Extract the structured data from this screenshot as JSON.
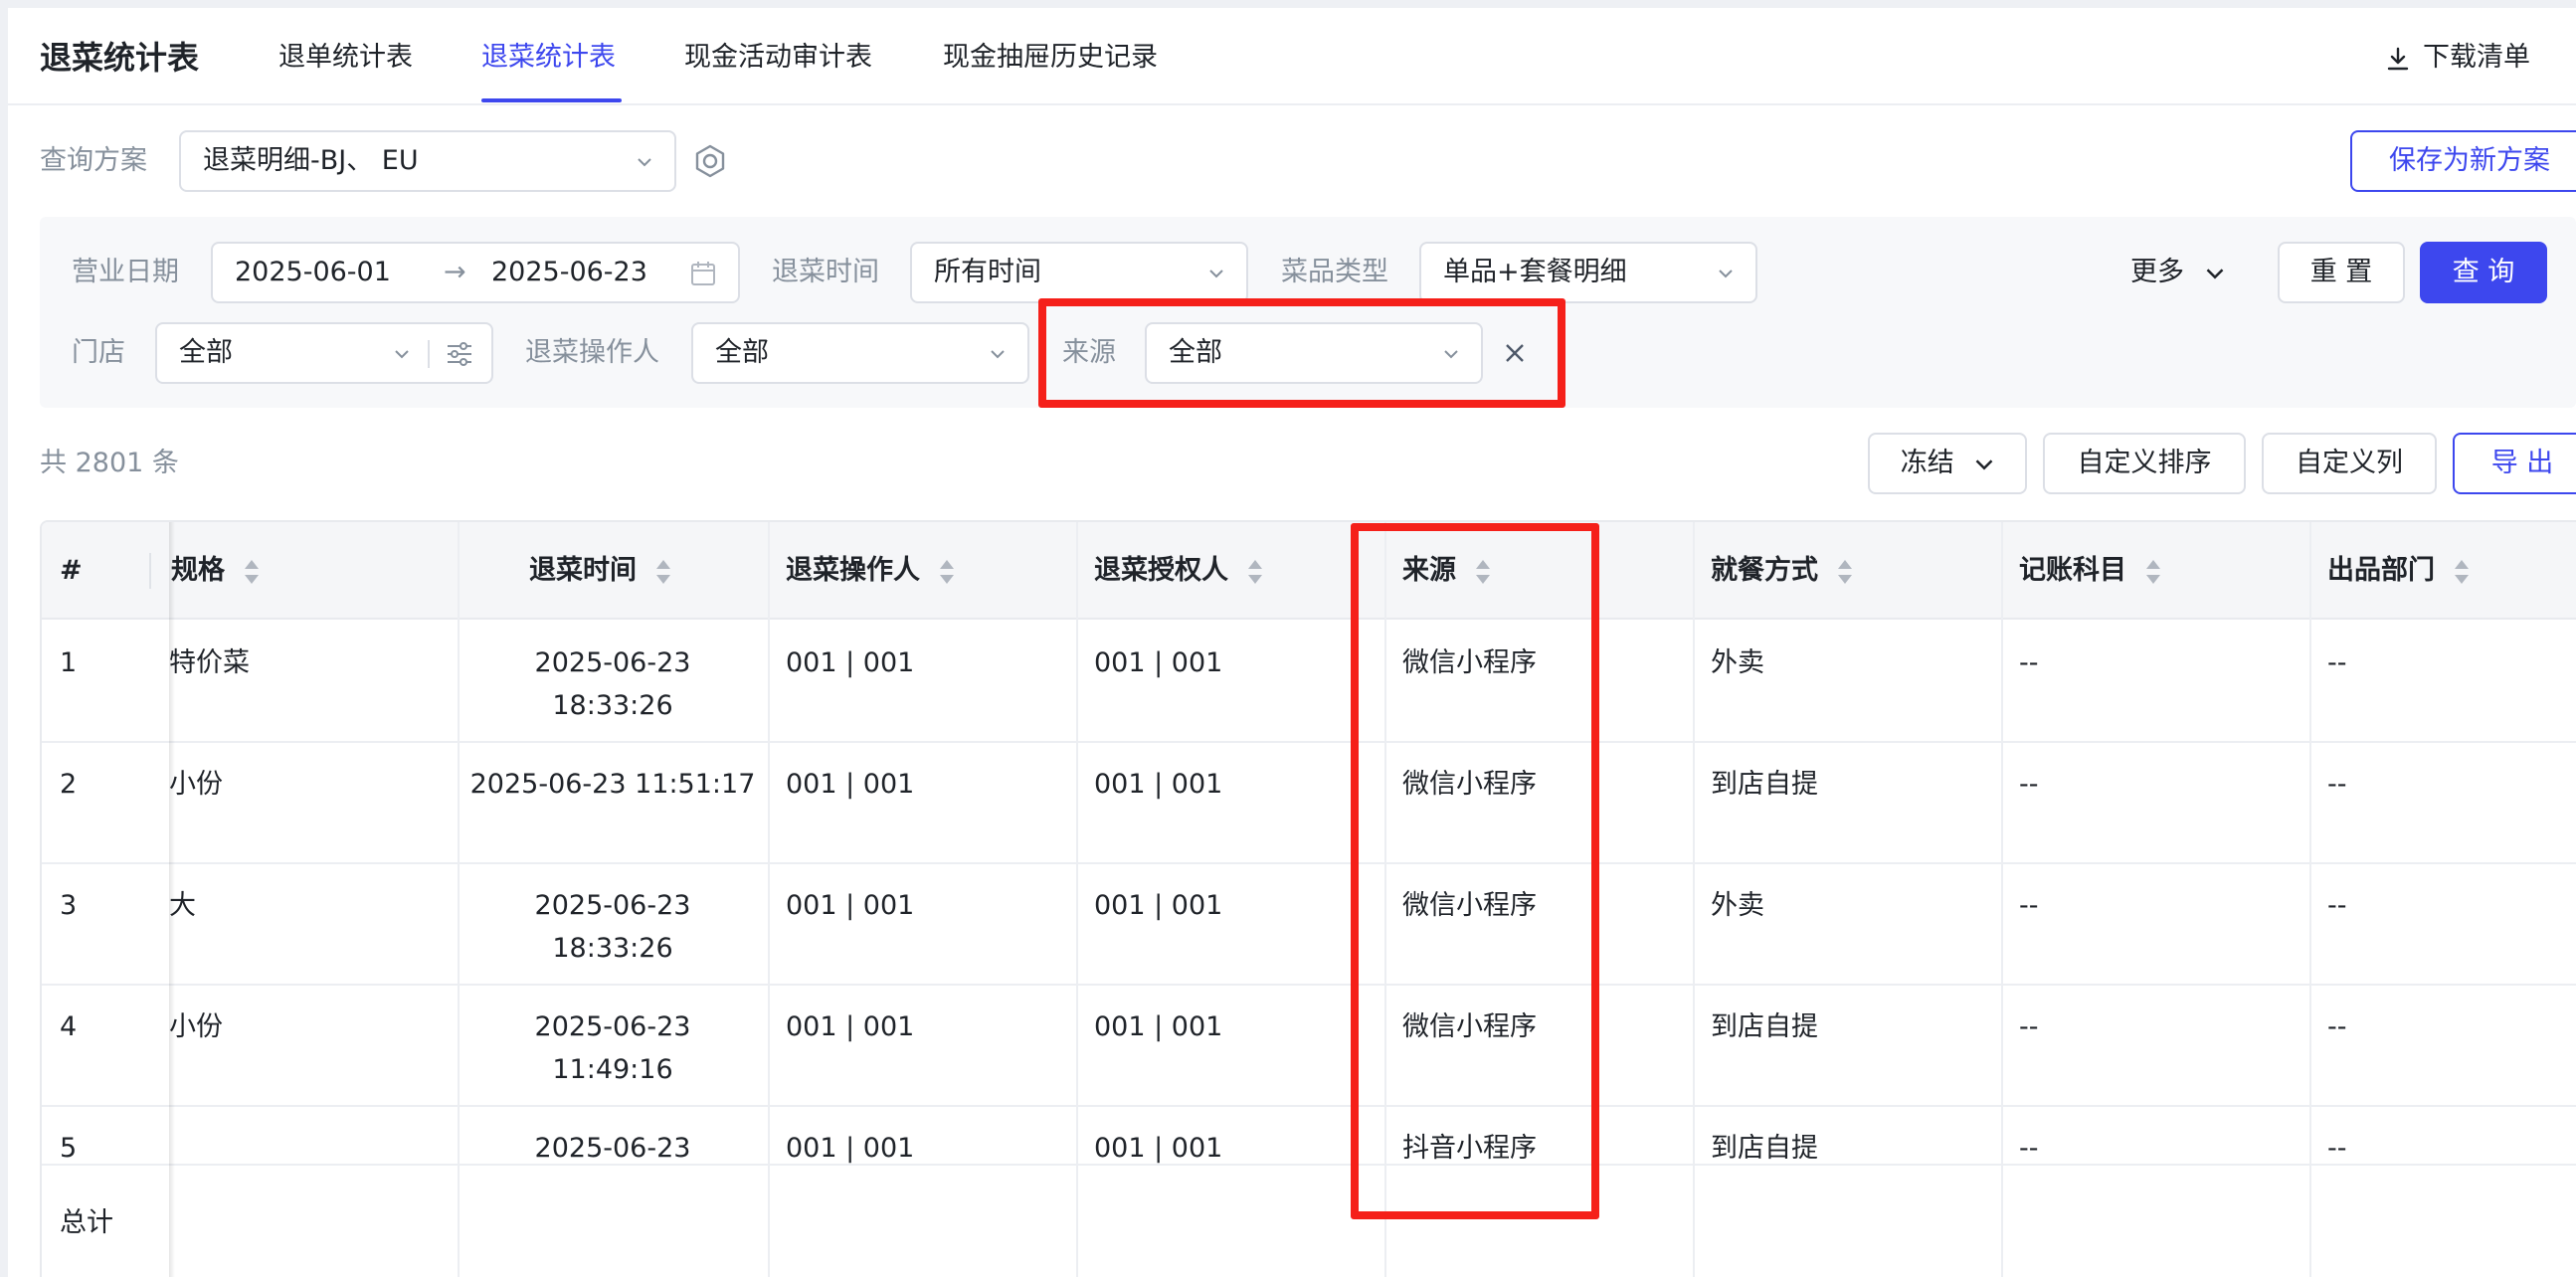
{
  "header": {
    "title": "退菜统计表",
    "tabs": [
      {
        "label": "退单统计表",
        "active": false
      },
      {
        "label": "退菜统计表",
        "active": true
      },
      {
        "label": "现金活动审计表",
        "active": false
      },
      {
        "label": "现金抽屉历史记录",
        "active": false
      }
    ],
    "download_label": "下载清单"
  },
  "scheme": {
    "label": "查询方案",
    "value": "退菜明细-BJ、 EU",
    "save_button": "保存为新方案"
  },
  "filters": {
    "business_date": {
      "label": "营业日期",
      "start": "2025-06-01",
      "end": "2025-06-23"
    },
    "return_time": {
      "label": "退菜时间",
      "value": "所有时间"
    },
    "dish_type": {
      "label": "菜品类型",
      "value": "单品+套餐明细"
    },
    "more_label": "更多",
    "reset_button": "重 置",
    "query_button": "查 询",
    "store": {
      "label": "门店",
      "value": "全部"
    },
    "operator": {
      "label": "退菜操作人",
      "value": "全部"
    },
    "source": {
      "label": "来源",
      "value": "全部"
    }
  },
  "toolbar": {
    "count_text": "共 2801 条",
    "freeze_label": "冻结",
    "custom_sort_label": "自定义排序",
    "custom_columns_label": "自定义列",
    "export_label": "导 出"
  },
  "table": {
    "columns": [
      "#",
      "规格",
      "退菜时间",
      "退菜操作人",
      "退菜授权人",
      "来源",
      "就餐方式",
      "记账科目",
      "出品部门"
    ],
    "rows": [
      [
        "1",
        "特价菜",
        "2025-06-23 18:33:26",
        "001 | 001",
        "001 | 001",
        "微信小程序",
        "外卖",
        "--",
        "--"
      ],
      [
        "2",
        "小份",
        "2025-06-23 11:51:17",
        "001 | 001",
        "001 | 001",
        "微信小程序",
        "到店自提",
        "--",
        "--"
      ],
      [
        "3",
        "大",
        "2025-06-23 18:33:26",
        "001 | 001",
        "001 | 001",
        "微信小程序",
        "外卖",
        "--",
        "--"
      ],
      [
        "4",
        "小份",
        "2025-06-23 11:49:16",
        "001 | 001",
        "001 | 001",
        "微信小程序",
        "到店自提",
        "--",
        "--"
      ],
      [
        "5",
        "",
        "2025-06-23",
        "001 | 001",
        "001 | 001",
        "抖音小程序",
        "到店自提",
        "--",
        "--"
      ]
    ],
    "total_label": "总计"
  },
  "colors": {
    "primary": "#3d47ee",
    "highlight": "#f5201a"
  }
}
